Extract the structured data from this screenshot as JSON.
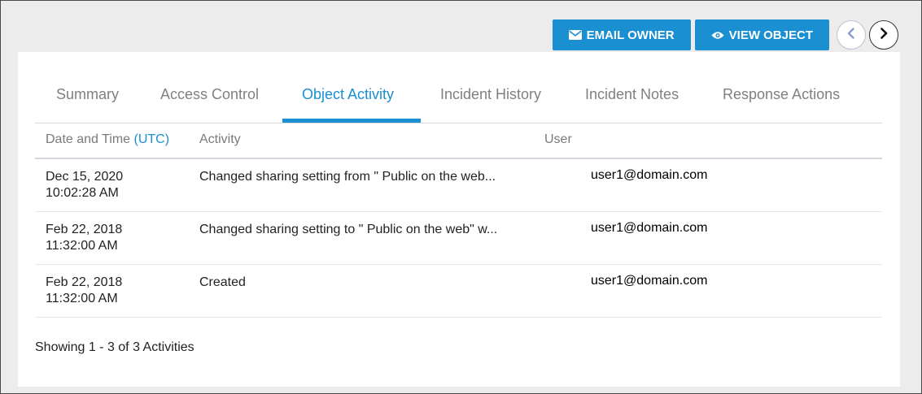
{
  "toolbar": {
    "email_owner_label": "EMAIL OWNER",
    "view_object_label": "VIEW OBJECT",
    "prev_icon": "chevron-left-icon",
    "next_icon": "chevron-right-icon"
  },
  "tabs": [
    {
      "label": "Summary",
      "active": false
    },
    {
      "label": "Access Control",
      "active": false
    },
    {
      "label": "Object Activity",
      "active": true
    },
    {
      "label": "Incident History",
      "active": false
    },
    {
      "label": "Incident Notes",
      "active": false
    },
    {
      "label": "Response Actions",
      "active": false
    }
  ],
  "table": {
    "columns": {
      "date_label": "Date and Time",
      "date_tz": "(UTC)",
      "activity": "Activity",
      "user": "User"
    },
    "rows": [
      {
        "date": "Dec 15, 2020",
        "time": "10:02:28 AM",
        "activity": "Changed sharing setting from \" Public on the web...",
        "user": "user1@domain.com"
      },
      {
        "date": "Feb 22, 2018",
        "time": "11:32:00 AM",
        "activity": "Changed sharing setting to \" Public on the web\"  w...",
        "user": "user1@domain.com"
      },
      {
        "date": "Feb 22, 2018",
        "time": "11:32:00 AM",
        "activity": "Created",
        "user": "user1@domain.com"
      }
    ]
  },
  "footer": {
    "count_text": "Showing 1 - 3 of 3 Activities"
  },
  "colors": {
    "accent": "#1a8fd1",
    "background": "#ececec"
  }
}
